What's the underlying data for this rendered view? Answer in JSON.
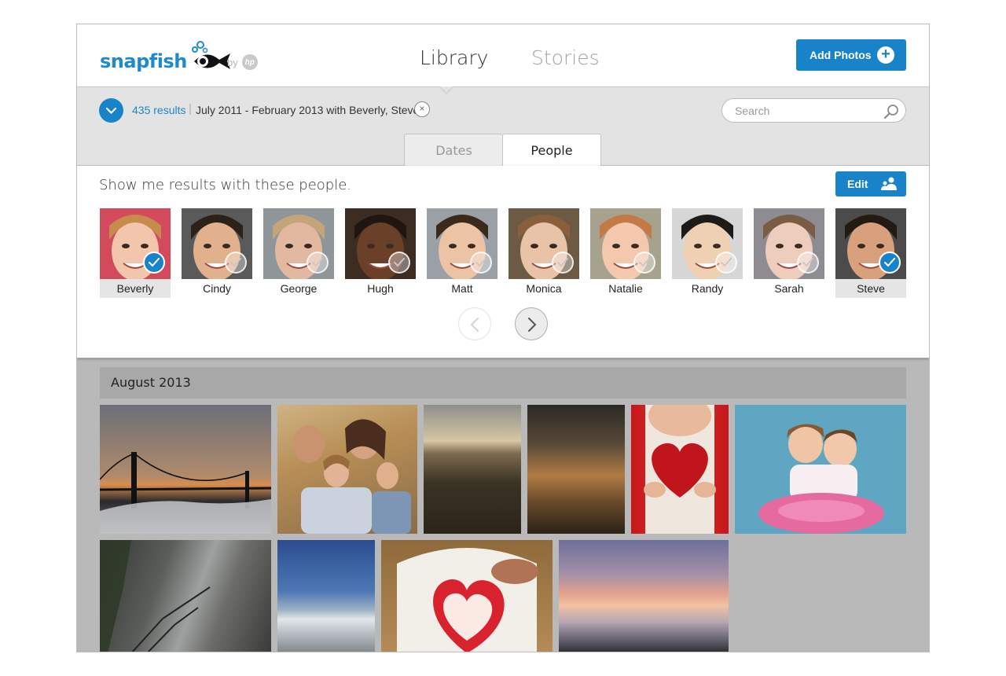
{
  "header": {
    "logo_text": "snapfish",
    "by_text": "by",
    "hp_badge": "hp",
    "nav": [
      {
        "label": "Library",
        "active": true
      },
      {
        "label": "Stories",
        "active": false
      }
    ],
    "add_photos_label": "Add Photos",
    "add_photos_icon": "+"
  },
  "filter_bar": {
    "results_count": "435 results",
    "separator": "|",
    "filter_text": "July 2011 - February 2013 with Beverly, Steve",
    "clear_icon": "×",
    "search": {
      "placeholder": "Search",
      "value": ""
    },
    "tabs": [
      {
        "label": "Dates",
        "active": false
      },
      {
        "label": "People",
        "active": true
      }
    ]
  },
  "people_panel": {
    "prompt": "Show me results with these people.",
    "edit_label": "Edit",
    "people": [
      {
        "name": "Beverly",
        "selected": true
      },
      {
        "name": "Cindy",
        "selected": false
      },
      {
        "name": "George",
        "selected": false
      },
      {
        "name": "Hugh",
        "selected": false
      },
      {
        "name": "Matt",
        "selected": false
      },
      {
        "name": "Monica",
        "selected": false
      },
      {
        "name": "Natalie",
        "selected": false
      },
      {
        "name": "Randy",
        "selected": false
      },
      {
        "name": "Sarah",
        "selected": false
      },
      {
        "name": "Steve",
        "selected": true
      }
    ]
  },
  "gallery": {
    "month_label": "August 2013"
  },
  "colors": {
    "accent": "#1883c8",
    "link": "#1b86cc",
    "panel_bg": "#e3e3e3",
    "gallery_bg": "#b9b9b9"
  },
  "icons": [
    "fish-logo-icon",
    "hp-logo-icon",
    "plus-icon",
    "chevron-down-icon",
    "close-icon",
    "search-icon",
    "people-icon",
    "check-icon",
    "chevron-left-icon",
    "chevron-right-icon"
  ]
}
